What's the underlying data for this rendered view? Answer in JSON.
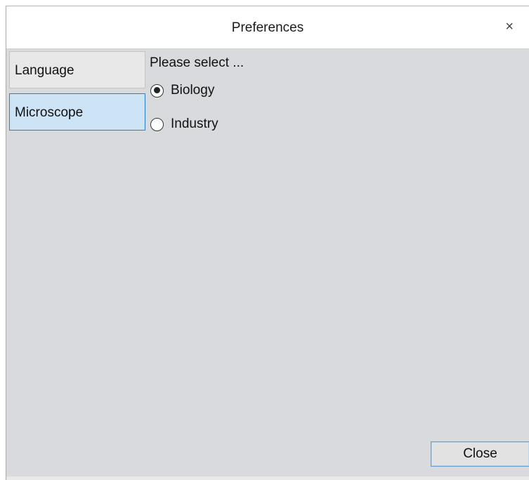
{
  "window": {
    "title": "Preferences",
    "close_glyph": "×"
  },
  "sidebar": {
    "tabs": [
      {
        "label": "Language",
        "selected": false
      },
      {
        "label": "Microscope",
        "selected": true
      }
    ]
  },
  "content": {
    "prompt": "Please select ...",
    "options": [
      {
        "label": "Biology",
        "checked": true
      },
      {
        "label": "Industry",
        "checked": false
      }
    ]
  },
  "footer": {
    "close_label": "Close"
  },
  "colors": {
    "window_bg": "#d9dadd",
    "selected_tab_bg": "#cde4f7",
    "selected_tab_border": "#2f7fc8",
    "button_border": "#5e9dd3"
  }
}
